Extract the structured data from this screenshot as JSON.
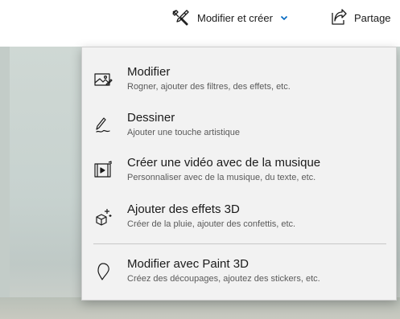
{
  "toolbar": {
    "edit_create_label": "Modifier et créer",
    "share_label": "Partage",
    "accent_color": "#0067c0"
  },
  "menu": {
    "items": [
      {
        "title": "Modifier",
        "description": "Rogner, ajouter des filtres, des effets, etc.",
        "icon": "photo-edit-icon"
      },
      {
        "title": "Dessiner",
        "description": "Ajouter une touche artistique",
        "icon": "pen-draw-icon"
      },
      {
        "title": "Créer une vidéo avec de la musique",
        "description": "Personnaliser avec de la musique, du texte, etc.",
        "icon": "video-music-icon"
      },
      {
        "title": "Ajouter des effets 3D",
        "description": "Créer de la pluie, ajouter des confettis, etc.",
        "icon": "sparkle-3d-icon"
      },
      {
        "title": "Modifier avec Paint 3D",
        "description": "Créez des découpages, ajoutez des stickers, etc.",
        "icon": "paint3d-icon"
      }
    ]
  }
}
